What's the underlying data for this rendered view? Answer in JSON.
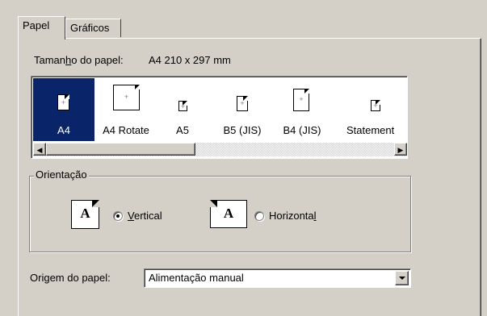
{
  "tabs": [
    {
      "label": "Papel",
      "active": true
    },
    {
      "label": "Gráficos",
      "active": false
    }
  ],
  "paper_size": {
    "label_pre": "Taman",
    "label_hot": "h",
    "label_post": "o do papel:",
    "value": "A4 210 x 297 mm"
  },
  "paper_list": {
    "items": [
      {
        "label": "A4",
        "selected": true
      },
      {
        "label": "A4 Rotate",
        "selected": false
      },
      {
        "label": "A5",
        "selected": false
      },
      {
        "label": "B5 (JIS)",
        "selected": false
      },
      {
        "label": "B4 (JIS)",
        "selected": false
      },
      {
        "label": "Statement",
        "selected": false
      }
    ],
    "scroll_left_icon": "arrow-left-icon",
    "scroll_right_icon": "arrow-right-icon"
  },
  "orientation": {
    "legend": "Orientação",
    "vertical": {
      "hot": "V",
      "rest": "ertical",
      "selected": true
    },
    "horizontal": {
      "pre": "Horizonta",
      "hot": "l",
      "selected": false
    },
    "page_glyph": "A"
  },
  "source": {
    "label_pre": "Ori",
    "label_hot": "g",
    "label_post": "em do papel:",
    "value": "Alimentação manual"
  },
  "colors": {
    "face": "#d4d0c8",
    "selection": "#0a246a"
  }
}
